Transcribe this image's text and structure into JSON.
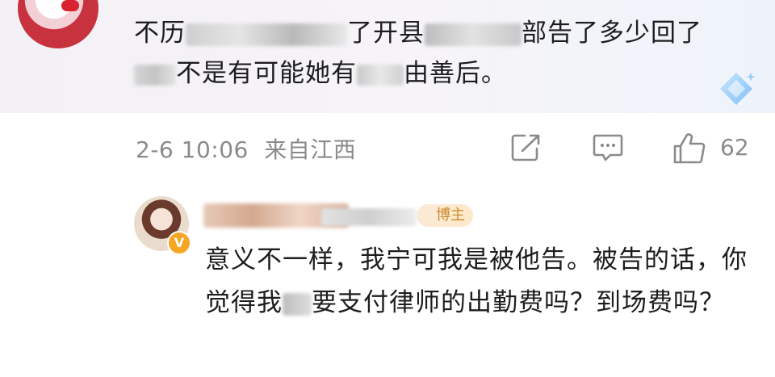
{
  "comment1": {
    "segments": [
      "不历",
      "",
      "了开县",
      "",
      "",
      "部告了多少回了",
      "",
      "不是有可能她有",
      "",
      "由善后。"
    ]
  },
  "meta": {
    "date": "2-6 10:06",
    "location": "来自江西",
    "like_count": "62"
  },
  "reply": {
    "role_tag": "博主",
    "segments": [
      "意义不一样，我宁可我是被他告。被告的话，你觉得我",
      "",
      "要支付律师的出勤费吗？到场费吗？"
    ]
  },
  "icons": {
    "share": "share-icon",
    "comment": "comment-icon",
    "like": "like-icon",
    "verified": "verified-v-icon",
    "badge": "diamond-badge-icon"
  },
  "colors": {
    "accent_orange": "#f5a623",
    "meta_gray": "#8a8a8a",
    "tag_text": "#c98a2b"
  }
}
